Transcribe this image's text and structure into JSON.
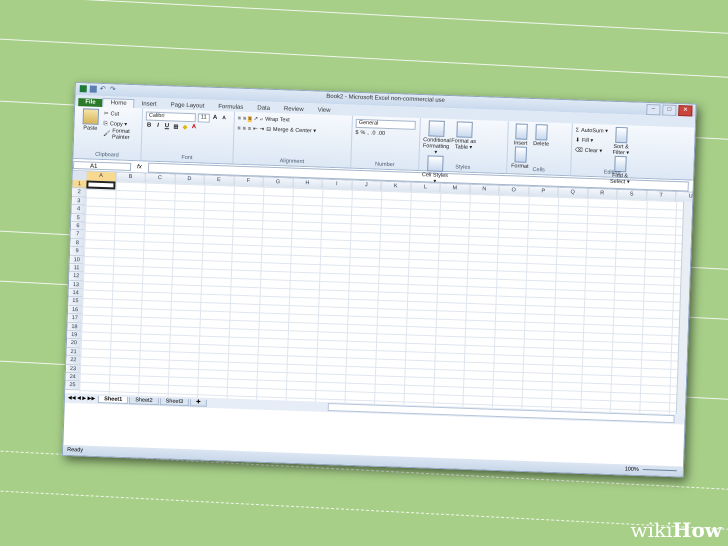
{
  "window": {
    "title": "Book2 - Microsoft Excel non-commercial use"
  },
  "tabs": [
    "File",
    "Home",
    "Insert",
    "Page Layout",
    "Formulas",
    "Data",
    "Review",
    "View"
  ],
  "clipboard": {
    "paste": "Paste",
    "cut": "Cut",
    "copy": "Copy ▾",
    "format_painter": "Format Painter",
    "label": "Clipboard"
  },
  "font": {
    "name": "Calibri",
    "size": "11",
    "label": "Font"
  },
  "alignment": {
    "wrap": "Wrap Text",
    "merge": "Merge & Center ▾",
    "label": "Alignment"
  },
  "number": {
    "format": "General",
    "label": "Number",
    "pct": "%",
    "comma": ","
  },
  "styles": {
    "conditional": "Conditional Formatting ▾",
    "format_table": "Format as Table ▾",
    "cell_styles": "Cell Styles ▾",
    "label": "Styles"
  },
  "cells": {
    "insert": "Insert",
    "delete": "Delete",
    "format": "Format",
    "label": "Cells"
  },
  "editing": {
    "autosum": "AutoSum ▾",
    "fill": "Fill ▾",
    "clear": "Clear ▾",
    "sort": "Sort & Filter ▾",
    "find": "Find & Select ▾",
    "label": "Editing"
  },
  "formula_bar": {
    "name_box": "A1",
    "fx": "fx",
    "value": ""
  },
  "columns": [
    "A",
    "B",
    "C",
    "D",
    "E",
    "F",
    "G",
    "H",
    "I",
    "J",
    "K",
    "L",
    "M",
    "N",
    "O",
    "P",
    "Q",
    "R",
    "S",
    "T",
    "U"
  ],
  "rows": [
    "1",
    "2",
    "3",
    "4",
    "5",
    "6",
    "7",
    "8",
    "9",
    "10",
    "11",
    "12",
    "13",
    "14",
    "15",
    "16",
    "17",
    "18",
    "19",
    "20",
    "21",
    "22",
    "23",
    "24",
    "25"
  ],
  "sheets": [
    "Sheet1",
    "Sheet2",
    "Sheet3"
  ],
  "status": {
    "ready": "Ready",
    "zoom": "100%"
  },
  "watermark": {
    "part1": "wiki",
    "part2": "How"
  }
}
